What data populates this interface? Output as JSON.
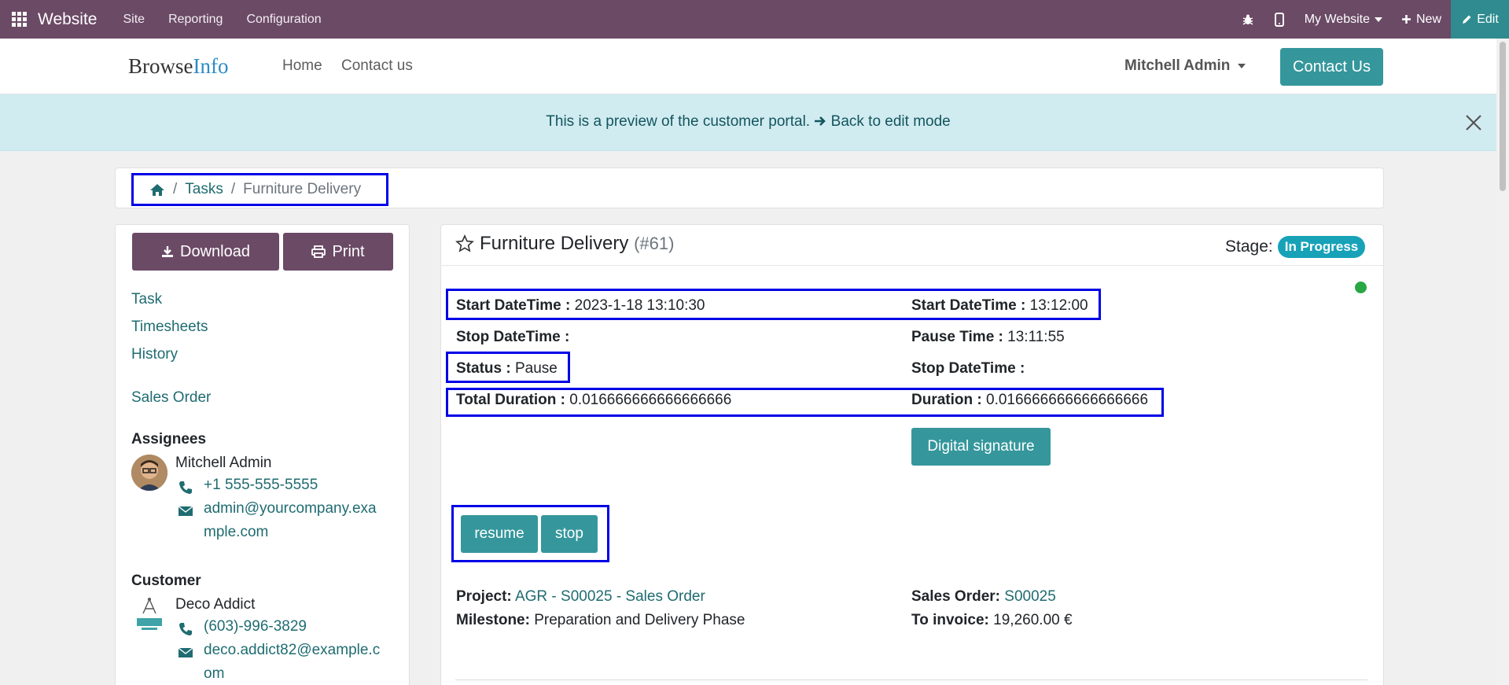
{
  "topbar": {
    "app_name": "Website",
    "menus": [
      "Site",
      "Reporting",
      "Configuration"
    ],
    "my_website": "My Website",
    "new_label": "New",
    "edit_label": "Edit"
  },
  "site_header": {
    "logo_part1": "Browse",
    "logo_part2": "Info",
    "nav": [
      "Home",
      "Contact us"
    ],
    "user": "Mitchell Admin",
    "contact_button": "Contact Us"
  },
  "banner": {
    "message": "This is a preview of the customer portal.",
    "back_link": "Back to edit mode"
  },
  "breadcrumb": {
    "tasks": "Tasks",
    "separator": "/",
    "current": "Furniture Delivery"
  },
  "sidebar": {
    "download_label": "Download",
    "print_label": "Print",
    "links": [
      "Task",
      "Timesheets",
      "History"
    ],
    "sales_order_link": "Sales Order",
    "assignees_heading": "Assignees",
    "assignee": {
      "name": "Mitchell Admin",
      "phone": "+1 555-555-5555",
      "email_line1": "admin@yourcompany.exa",
      "email_line2": "mple.com"
    },
    "customer_heading": "Customer",
    "customer": {
      "name": "Deco Addict",
      "phone": "(603)-996-3829",
      "email_line1": "deco.addict82@example.c",
      "email_line2": "om"
    }
  },
  "task": {
    "title": "Furniture Delivery",
    "number": "(#61)",
    "stage_label": "Stage:",
    "stage": "In Progress",
    "fields": {
      "start_datetime_label": "Start DateTime :",
      "start_datetime_value": "2023-1-18 13:10:30",
      "start_datetime2_label": "Start DateTime :",
      "start_datetime2_value": "13:12:00",
      "stop_datetime_label": "Stop DateTime :",
      "stop_datetime_value": "",
      "pause_time_label": "Pause Time :",
      "pause_time_value": "13:11:55",
      "status_label": "Status :",
      "status_value": "Pause",
      "stop_datetime2_label": "Stop DateTime :",
      "stop_datetime2_value": "",
      "total_duration_label": "Total Duration :",
      "total_duration_value": "0.016666666666666666",
      "duration_label": "Duration :",
      "duration_value": "0.016666666666666666"
    },
    "digital_signature": "Digital signature",
    "resume_label": "resume",
    "stop_label": "stop",
    "project_label": "Project:",
    "project_value": "AGR - S00025 - Sales Order",
    "milestone_label": "Milestone:",
    "milestone_value": "Preparation and Delivery Phase",
    "sales_order_label": "Sales Order:",
    "sales_order_value": "S00025",
    "to_invoice_label": "To invoice:",
    "to_invoice_value": "19,260.00 €"
  },
  "colors": {
    "topbar": "#6b4a66",
    "accent": "#35979c",
    "highlight": "#0000e6",
    "link": "#1f6c71",
    "badge": "#17a2b8"
  }
}
